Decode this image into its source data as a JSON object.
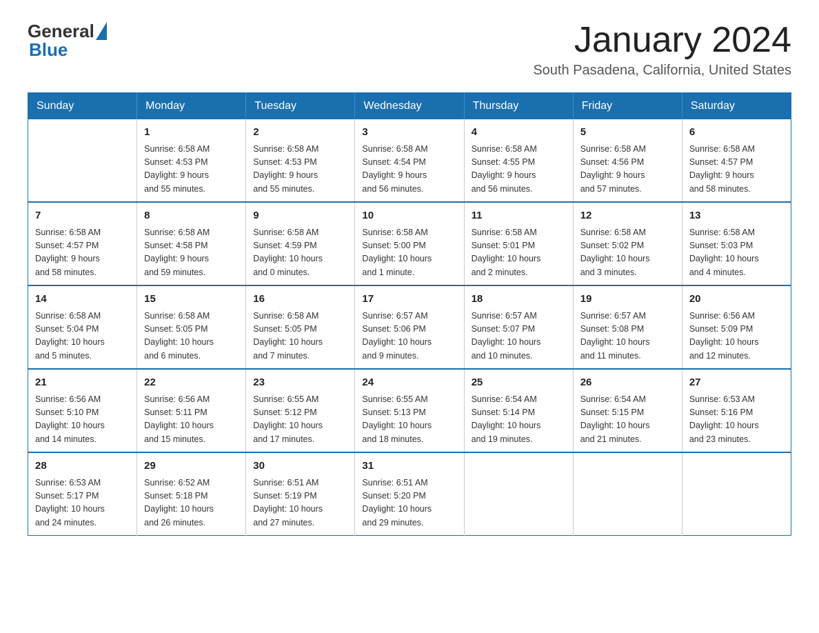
{
  "header": {
    "logo": {
      "general": "General",
      "blue": "Blue"
    },
    "title": "January 2024",
    "subtitle": "South Pasadena, California, United States"
  },
  "weekdays": [
    "Sunday",
    "Monday",
    "Tuesday",
    "Wednesday",
    "Thursday",
    "Friday",
    "Saturday"
  ],
  "weeks": [
    [
      {
        "day": "",
        "info": ""
      },
      {
        "day": "1",
        "info": "Sunrise: 6:58 AM\nSunset: 4:53 PM\nDaylight: 9 hours\nand 55 minutes."
      },
      {
        "day": "2",
        "info": "Sunrise: 6:58 AM\nSunset: 4:53 PM\nDaylight: 9 hours\nand 55 minutes."
      },
      {
        "day": "3",
        "info": "Sunrise: 6:58 AM\nSunset: 4:54 PM\nDaylight: 9 hours\nand 56 minutes."
      },
      {
        "day": "4",
        "info": "Sunrise: 6:58 AM\nSunset: 4:55 PM\nDaylight: 9 hours\nand 56 minutes."
      },
      {
        "day": "5",
        "info": "Sunrise: 6:58 AM\nSunset: 4:56 PM\nDaylight: 9 hours\nand 57 minutes."
      },
      {
        "day": "6",
        "info": "Sunrise: 6:58 AM\nSunset: 4:57 PM\nDaylight: 9 hours\nand 58 minutes."
      }
    ],
    [
      {
        "day": "7",
        "info": "Sunrise: 6:58 AM\nSunset: 4:57 PM\nDaylight: 9 hours\nand 58 minutes."
      },
      {
        "day": "8",
        "info": "Sunrise: 6:58 AM\nSunset: 4:58 PM\nDaylight: 9 hours\nand 59 minutes."
      },
      {
        "day": "9",
        "info": "Sunrise: 6:58 AM\nSunset: 4:59 PM\nDaylight: 10 hours\nand 0 minutes."
      },
      {
        "day": "10",
        "info": "Sunrise: 6:58 AM\nSunset: 5:00 PM\nDaylight: 10 hours\nand 1 minute."
      },
      {
        "day": "11",
        "info": "Sunrise: 6:58 AM\nSunset: 5:01 PM\nDaylight: 10 hours\nand 2 minutes."
      },
      {
        "day": "12",
        "info": "Sunrise: 6:58 AM\nSunset: 5:02 PM\nDaylight: 10 hours\nand 3 minutes."
      },
      {
        "day": "13",
        "info": "Sunrise: 6:58 AM\nSunset: 5:03 PM\nDaylight: 10 hours\nand 4 minutes."
      }
    ],
    [
      {
        "day": "14",
        "info": "Sunrise: 6:58 AM\nSunset: 5:04 PM\nDaylight: 10 hours\nand 5 minutes."
      },
      {
        "day": "15",
        "info": "Sunrise: 6:58 AM\nSunset: 5:05 PM\nDaylight: 10 hours\nand 6 minutes."
      },
      {
        "day": "16",
        "info": "Sunrise: 6:58 AM\nSunset: 5:05 PM\nDaylight: 10 hours\nand 7 minutes."
      },
      {
        "day": "17",
        "info": "Sunrise: 6:57 AM\nSunset: 5:06 PM\nDaylight: 10 hours\nand 9 minutes."
      },
      {
        "day": "18",
        "info": "Sunrise: 6:57 AM\nSunset: 5:07 PM\nDaylight: 10 hours\nand 10 minutes."
      },
      {
        "day": "19",
        "info": "Sunrise: 6:57 AM\nSunset: 5:08 PM\nDaylight: 10 hours\nand 11 minutes."
      },
      {
        "day": "20",
        "info": "Sunrise: 6:56 AM\nSunset: 5:09 PM\nDaylight: 10 hours\nand 12 minutes."
      }
    ],
    [
      {
        "day": "21",
        "info": "Sunrise: 6:56 AM\nSunset: 5:10 PM\nDaylight: 10 hours\nand 14 minutes."
      },
      {
        "day": "22",
        "info": "Sunrise: 6:56 AM\nSunset: 5:11 PM\nDaylight: 10 hours\nand 15 minutes."
      },
      {
        "day": "23",
        "info": "Sunrise: 6:55 AM\nSunset: 5:12 PM\nDaylight: 10 hours\nand 17 minutes."
      },
      {
        "day": "24",
        "info": "Sunrise: 6:55 AM\nSunset: 5:13 PM\nDaylight: 10 hours\nand 18 minutes."
      },
      {
        "day": "25",
        "info": "Sunrise: 6:54 AM\nSunset: 5:14 PM\nDaylight: 10 hours\nand 19 minutes."
      },
      {
        "day": "26",
        "info": "Sunrise: 6:54 AM\nSunset: 5:15 PM\nDaylight: 10 hours\nand 21 minutes."
      },
      {
        "day": "27",
        "info": "Sunrise: 6:53 AM\nSunset: 5:16 PM\nDaylight: 10 hours\nand 23 minutes."
      }
    ],
    [
      {
        "day": "28",
        "info": "Sunrise: 6:53 AM\nSunset: 5:17 PM\nDaylight: 10 hours\nand 24 minutes."
      },
      {
        "day": "29",
        "info": "Sunrise: 6:52 AM\nSunset: 5:18 PM\nDaylight: 10 hours\nand 26 minutes."
      },
      {
        "day": "30",
        "info": "Sunrise: 6:51 AM\nSunset: 5:19 PM\nDaylight: 10 hours\nand 27 minutes."
      },
      {
        "day": "31",
        "info": "Sunrise: 6:51 AM\nSunset: 5:20 PM\nDaylight: 10 hours\nand 29 minutes."
      },
      {
        "day": "",
        "info": ""
      },
      {
        "day": "",
        "info": ""
      },
      {
        "day": "",
        "info": ""
      }
    ]
  ]
}
